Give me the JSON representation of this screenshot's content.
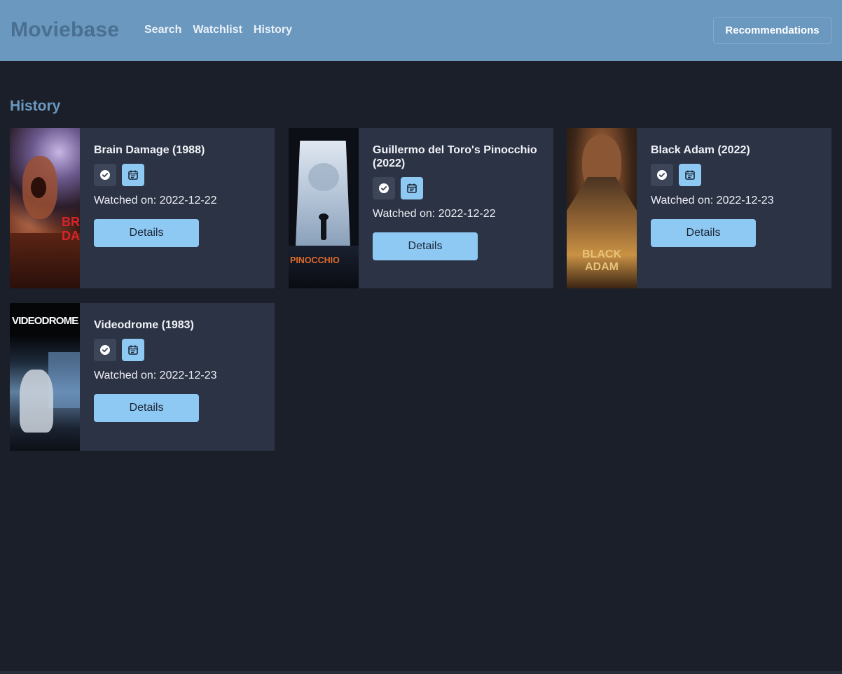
{
  "header": {
    "brand": "Moviebase",
    "nav": [
      "Search",
      "Watchlist",
      "History"
    ],
    "recommendations_label": "Recommendations"
  },
  "page": {
    "title": "History"
  },
  "movies": [
    {
      "title": "Brain Damage (1988)",
      "watched_on": "Watched on: 2022-12-22",
      "details_label": "Details",
      "poster_text": "BRAIN DAMAGE"
    },
    {
      "title": "Guillermo del Toro's Pinocchio (2022)",
      "watched_on": "Watched on: 2022-12-22",
      "details_label": "Details",
      "poster_text": "PINOCCHIO"
    },
    {
      "title": "Black Adam (2022)",
      "watched_on": "Watched on: 2022-12-23",
      "details_label": "Details",
      "poster_text": "BLACK ADAM"
    },
    {
      "title": "Videodrome (1983)",
      "watched_on": "Watched on: 2022-12-23",
      "details_label": "Details",
      "poster_text": "VIDEODROME"
    }
  ],
  "colors": {
    "background": "#1b1f2a",
    "header": "#6b98bf",
    "card": "#2c3345",
    "accent": "#8ec9f4"
  }
}
